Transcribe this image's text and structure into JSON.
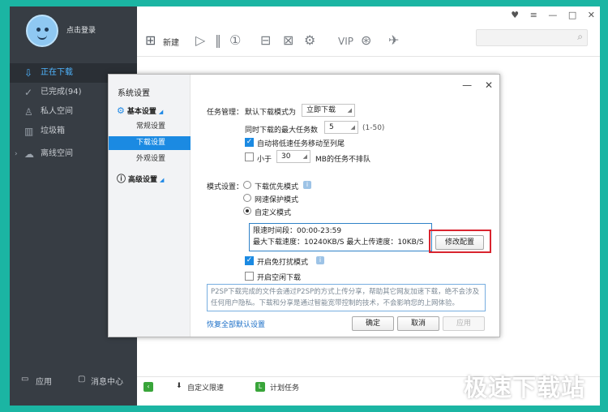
{
  "sidebar": {
    "login": "点击登录",
    "items": [
      {
        "label": "正在下载",
        "icon": "download-icon"
      },
      {
        "label": "已完成(94)",
        "icon": "check-circle-icon"
      },
      {
        "label": "私人空间",
        "icon": "user-icon"
      },
      {
        "label": "垃圾箱",
        "icon": "trash-icon"
      },
      {
        "label": "离线空间",
        "icon": "cloud-icon"
      }
    ],
    "bottom": {
      "apps": "应用",
      "messages": "消息中心"
    }
  },
  "toolbar": {
    "new_label": "新建"
  },
  "statusbar": {
    "custom_speed": "自定义限速",
    "plan_task": "计划任务"
  },
  "dialog": {
    "title": "系统设置",
    "tree": {
      "basic": "基本设置",
      "general": "常规设置",
      "download": "下载设置",
      "appearance": "外观设置",
      "advanced": "高级设置"
    },
    "task_mgmt": {
      "label": "任务管理：",
      "default_mode_label": "默认下载模式为",
      "default_mode_value": "立即下载",
      "max_tasks_label": "同时下载的最大任务数",
      "max_tasks_value": "5",
      "max_tasks_range": "(1-50)",
      "auto_move_label": "自动将低速任务移动至列尾",
      "auto_move_checked": true,
      "less_than_label": "小于",
      "less_than_value": "30",
      "less_than_suffix": "MB的任务不排队",
      "less_than_checked": false
    },
    "mode": {
      "label": "模式设置：",
      "download_first": "下载优先模式",
      "network_protect": "网速保护模式",
      "custom": "自定义模式",
      "selected": "custom",
      "limit_period": "限速时间段：00:00-23:59",
      "limit_speeds": "最大下载速度：10240KB/S  最大上传速度：10KB/S",
      "modify_button": "修改配置",
      "no_disturb": "开启免打扰模式",
      "no_disturb_checked": true,
      "idle_download": "开启空闲下载",
      "idle_download_checked": false
    },
    "note": "P2SP下载完成的文件会通过P2SP的方式上传分享，帮助其它网友加速下载，绝不会涉及任何用户隐私。下载和分享是通过智能宽带控制的技术，不会影响您的上网体验。",
    "restore_link": "恢复全部默认设置",
    "ok": "确定",
    "cancel": "取消",
    "apply": "应用"
  },
  "watermark": "极速下载站",
  "colors": {
    "accent": "#1b8ae2",
    "sidebar": "#373d44",
    "highlight": "#d9242f",
    "background": "#1bb5a3"
  }
}
